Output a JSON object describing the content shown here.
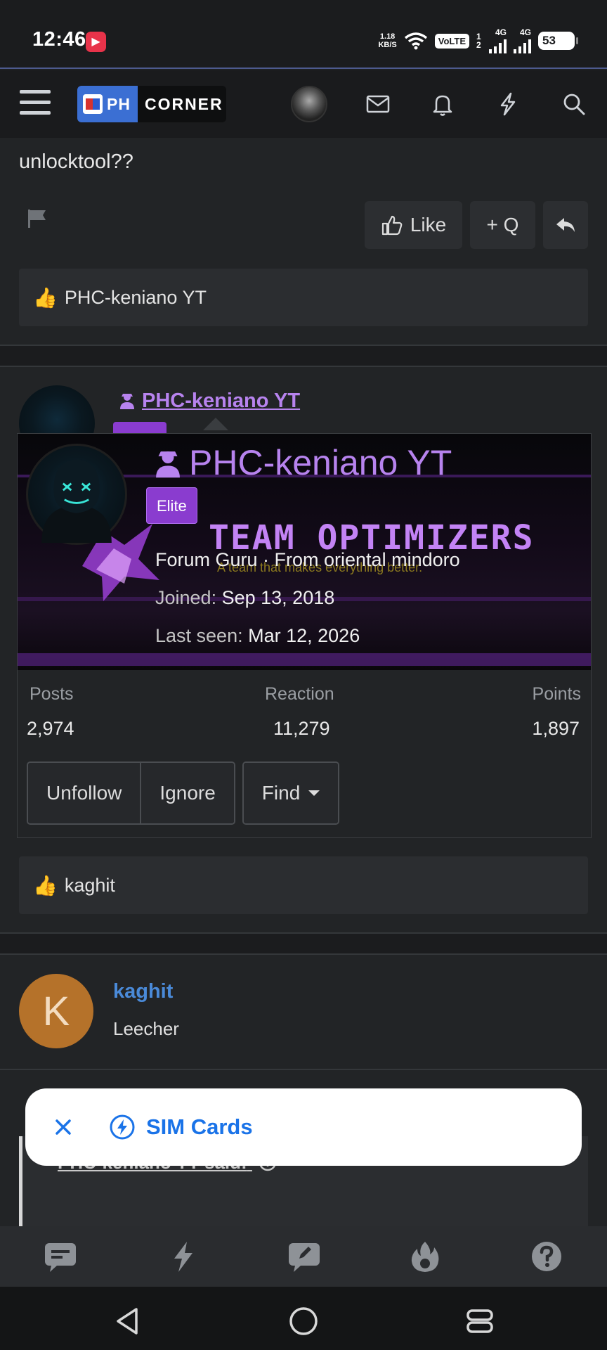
{
  "status_bar": {
    "time": "12:46",
    "net_speed_value": "1.18",
    "net_speed_unit": "KB/S",
    "volte": "VoLTE",
    "sim1_label": "4G",
    "sim2_label": "4G",
    "sim_numbers": "1 2",
    "battery": "53"
  },
  "header": {
    "logo_ph": "PH",
    "logo_corner": "CORNER"
  },
  "post": {
    "text": "unlocktool??",
    "like_label": "Like",
    "quote_label": "+ Q",
    "reaction_user": "PHC-keniano YT"
  },
  "second_post": {
    "author": "PHC-keniano YT",
    "reaction_user": "kaghit"
  },
  "member_card": {
    "name": "PHC-keniano YT",
    "badge": "Elite",
    "banner_title": "TEAM OPTIMIZERS",
    "banner_tagline": "A team that makes everything better.",
    "title_line": "Forum Guru · From oriental mindoro",
    "joined_label": "Joined:",
    "joined_value": "Sep 13, 2018",
    "last_seen_label": "Last seen:",
    "last_seen_value": "Mar 12, 2026",
    "stats": {
      "posts_label": "Posts",
      "posts_value": "2,974",
      "reaction_label": "Reaction",
      "reaction_value": "11,279",
      "points_label": "Points",
      "points_value": "1,897"
    },
    "buttons": {
      "unfollow": "Unfollow",
      "ignore": "Ignore",
      "find": "Find"
    }
  },
  "third_post": {
    "avatar_letter": "K",
    "author": "kaghit",
    "user_title": "Leecher",
    "quote_attribution": "PHC-keniano YT said:"
  },
  "toast": {
    "text": "SIM Cards"
  },
  "colors": {
    "accent_purple": "#b783ee",
    "link_blue": "#4a8ad8",
    "toast_blue": "#1a73e8",
    "kaghit_avatar": "#b5722a"
  }
}
